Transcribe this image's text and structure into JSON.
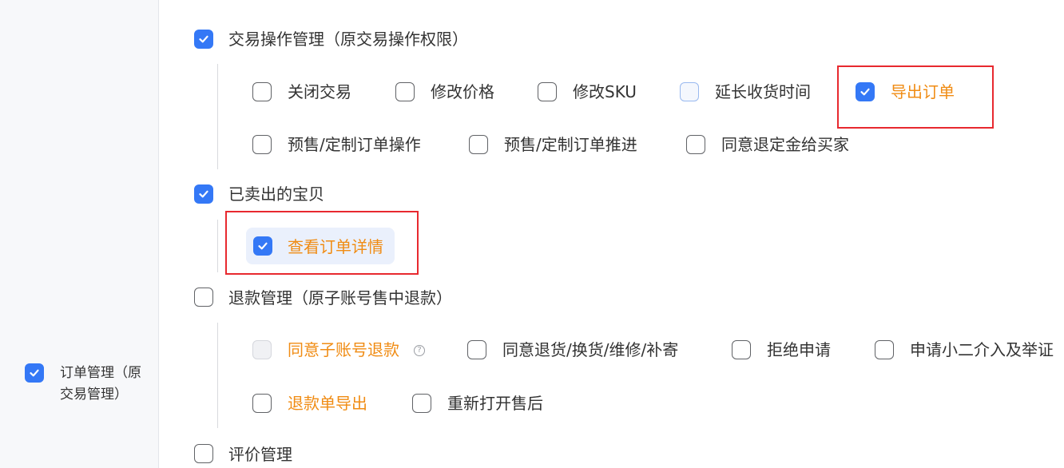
{
  "sidebar": {
    "item": {
      "label_line1": "订单管理（原",
      "label_line2": "交易管理）",
      "checked": true
    }
  },
  "groups": [
    {
      "label": "交易操作管理（原交易操作权限）",
      "checked": true,
      "items": [
        {
          "label": "关闭交易",
          "checked": false
        },
        {
          "label": "修改价格",
          "checked": false
        },
        {
          "label": "修改SKU",
          "checked": false
        },
        {
          "label": "延长收货时间",
          "checked": false
        },
        {
          "label": "导出订单",
          "checked": true,
          "highlighted": true
        },
        {
          "label": "预售/定制订单操作",
          "checked": false
        },
        {
          "label": "预售/定制订单推进",
          "checked": false
        },
        {
          "label": "同意退定金给买家",
          "checked": false
        }
      ]
    },
    {
      "label": "已卖出的宝贝",
      "checked": true,
      "items": [
        {
          "label": "查看订单详情",
          "checked": true,
          "highlighted": true
        }
      ]
    },
    {
      "label": "退款管理（原子账号售中退款）",
      "checked": false,
      "items": [
        {
          "label": "同意子账号退款",
          "checked": false,
          "disabled": true,
          "help_glyph": "?"
        },
        {
          "label": "同意退货/换货/维修/补寄",
          "checked": false
        },
        {
          "label": "拒绝申请",
          "checked": false
        },
        {
          "label": "申请小二介入及举证",
          "checked": false
        },
        {
          "label": "退款单导出",
          "checked": false
        },
        {
          "label": "重新打开售后",
          "checked": false
        }
      ]
    },
    {
      "label": "评价管理",
      "checked": false
    }
  ],
  "colors": {
    "accent_blue": "#3478f6",
    "highlight_orange": "#f08c14",
    "annotation_red": "#e8292f"
  }
}
